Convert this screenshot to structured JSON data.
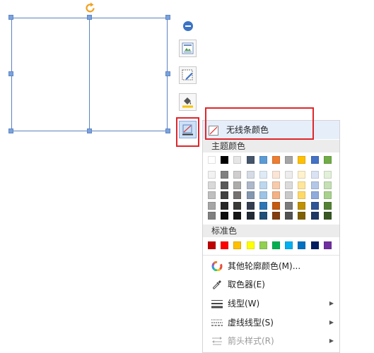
{
  "menu": {
    "no_line_color": "无线条颜色",
    "theme_colors_title": "主题颜色",
    "standard_colors_title": "标准色",
    "items": [
      {
        "label": "其他轮廓颜色(M)...",
        "icon": "color-wheel-icon",
        "submenu": false,
        "disabled": false
      },
      {
        "label": "取色器(E)",
        "icon": "eyedropper-icon",
        "submenu": false,
        "disabled": false
      },
      {
        "label": "线型(W)",
        "icon": "line-weight-icon",
        "submenu": true,
        "disabled": false
      },
      {
        "label": "虚线线型(S)",
        "icon": "dash-type-icon",
        "submenu": true,
        "disabled": false
      },
      {
        "label": "箭头样式(R)",
        "icon": "arrow-style-icon",
        "submenu": true,
        "disabled": true
      }
    ],
    "theme_base": [
      "#ffffff",
      "#000000",
      "#e7e6e6",
      "#44546a",
      "#5b9bd5",
      "#ed7d31",
      "#a5a5a5",
      "#ffc000",
      "#4472c4",
      "#70ad47"
    ],
    "theme_shades": [
      [
        "#f2f2f2",
        "#808080",
        "#d0cece",
        "#d6dce5",
        "#deebf7",
        "#fbe5d6",
        "#ededed",
        "#fff2cc",
        "#dae3f3",
        "#e2f0d9"
      ],
      [
        "#d9d9d9",
        "#595959",
        "#aeabab",
        "#adb9ca",
        "#bdd7ee",
        "#f8cbad",
        "#dbdbdb",
        "#ffe699",
        "#b4c7e7",
        "#c5e0b4"
      ],
      [
        "#bfbfbf",
        "#404040",
        "#757171",
        "#8497b0",
        "#9dc3e6",
        "#f4b183",
        "#c9c9c9",
        "#ffd966",
        "#8faadc",
        "#a9d18e"
      ],
      [
        "#a6a6a6",
        "#262626",
        "#3b3838",
        "#333f50",
        "#2e75b6",
        "#c55a11",
        "#7b7b7b",
        "#bf9000",
        "#2f5597",
        "#548235"
      ],
      [
        "#808080",
        "#0d0d0d",
        "#171616",
        "#222a35",
        "#1f4e79",
        "#843c0c",
        "#525252",
        "#7f6000",
        "#203864",
        "#385723"
      ]
    ],
    "standard": [
      "#c00000",
      "#ff0000",
      "#ffc000",
      "#ffff00",
      "#92d050",
      "#00b050",
      "#00b0f0",
      "#0070c0",
      "#002060",
      "#7030a0"
    ]
  },
  "toolbar": {
    "buttons": [
      {
        "name": "collapse-button",
        "icon": "minus-circle-icon"
      },
      {
        "name": "layout-options-button",
        "icon": "layout-options-icon"
      },
      {
        "name": "shape-style-button",
        "icon": "edit-shape-icon"
      },
      {
        "name": "fill-button",
        "icon": "paint-bucket-icon"
      },
      {
        "name": "outline-button",
        "icon": "outline-pen-icon"
      }
    ]
  },
  "colors": {
    "accent": "#5b82c0",
    "highlight": "#e0262b",
    "menu_hover": "#e6eefa"
  }
}
